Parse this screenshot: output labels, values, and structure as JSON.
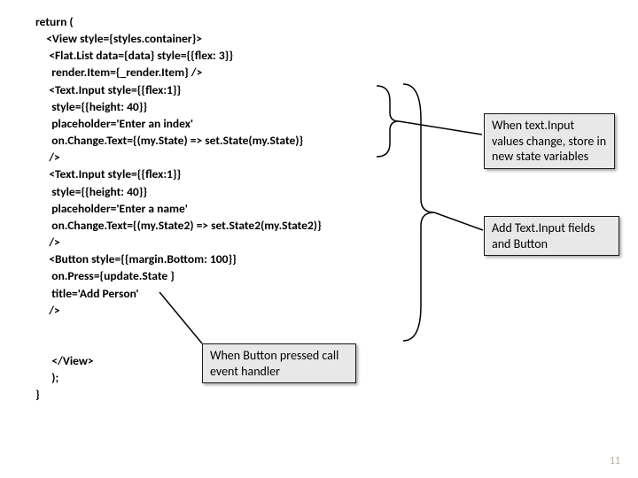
{
  "code": {
    "l0": "return (",
    "l1": "    <View style={styles.container}>",
    "l2": "     <Flat.List data={data} style={{flex: 3}}",
    "l3": "      render.Item={_render.Item} />",
    "l4": "     <Text.Input style={{flex:1}}",
    "l5": "      style={{height: 40}}",
    "l6": "      placeholder='Enter an index'",
    "l7": "      on.Change.Text={(my.State) => set.State(my.State)}",
    "l8": "     />",
    "l9": "     <Text.Input style={{flex:1}}",
    "l10": "      style={{height: 40}}",
    "l11": "      placeholder='Enter a name'",
    "l12": "      on.Change.Text={(my.State2) => set.State2(my.State2)}",
    "l13": "     />",
    "l14": "     <Button style={{margin.Bottom: 100}}",
    "l15": "      on.Press={update.State }",
    "l16": "      title='Add Person'",
    "l17": "     />",
    "l18": "",
    "l19": "",
    "l20": "      </View>",
    "l21": "      );",
    "l22": "}"
  },
  "callouts": {
    "c1": "When text.Input values change, store in new state variables",
    "c2": "Add Text.Input fields and Button",
    "c3": "When Button pressed call event handler"
  },
  "page_number": "11"
}
